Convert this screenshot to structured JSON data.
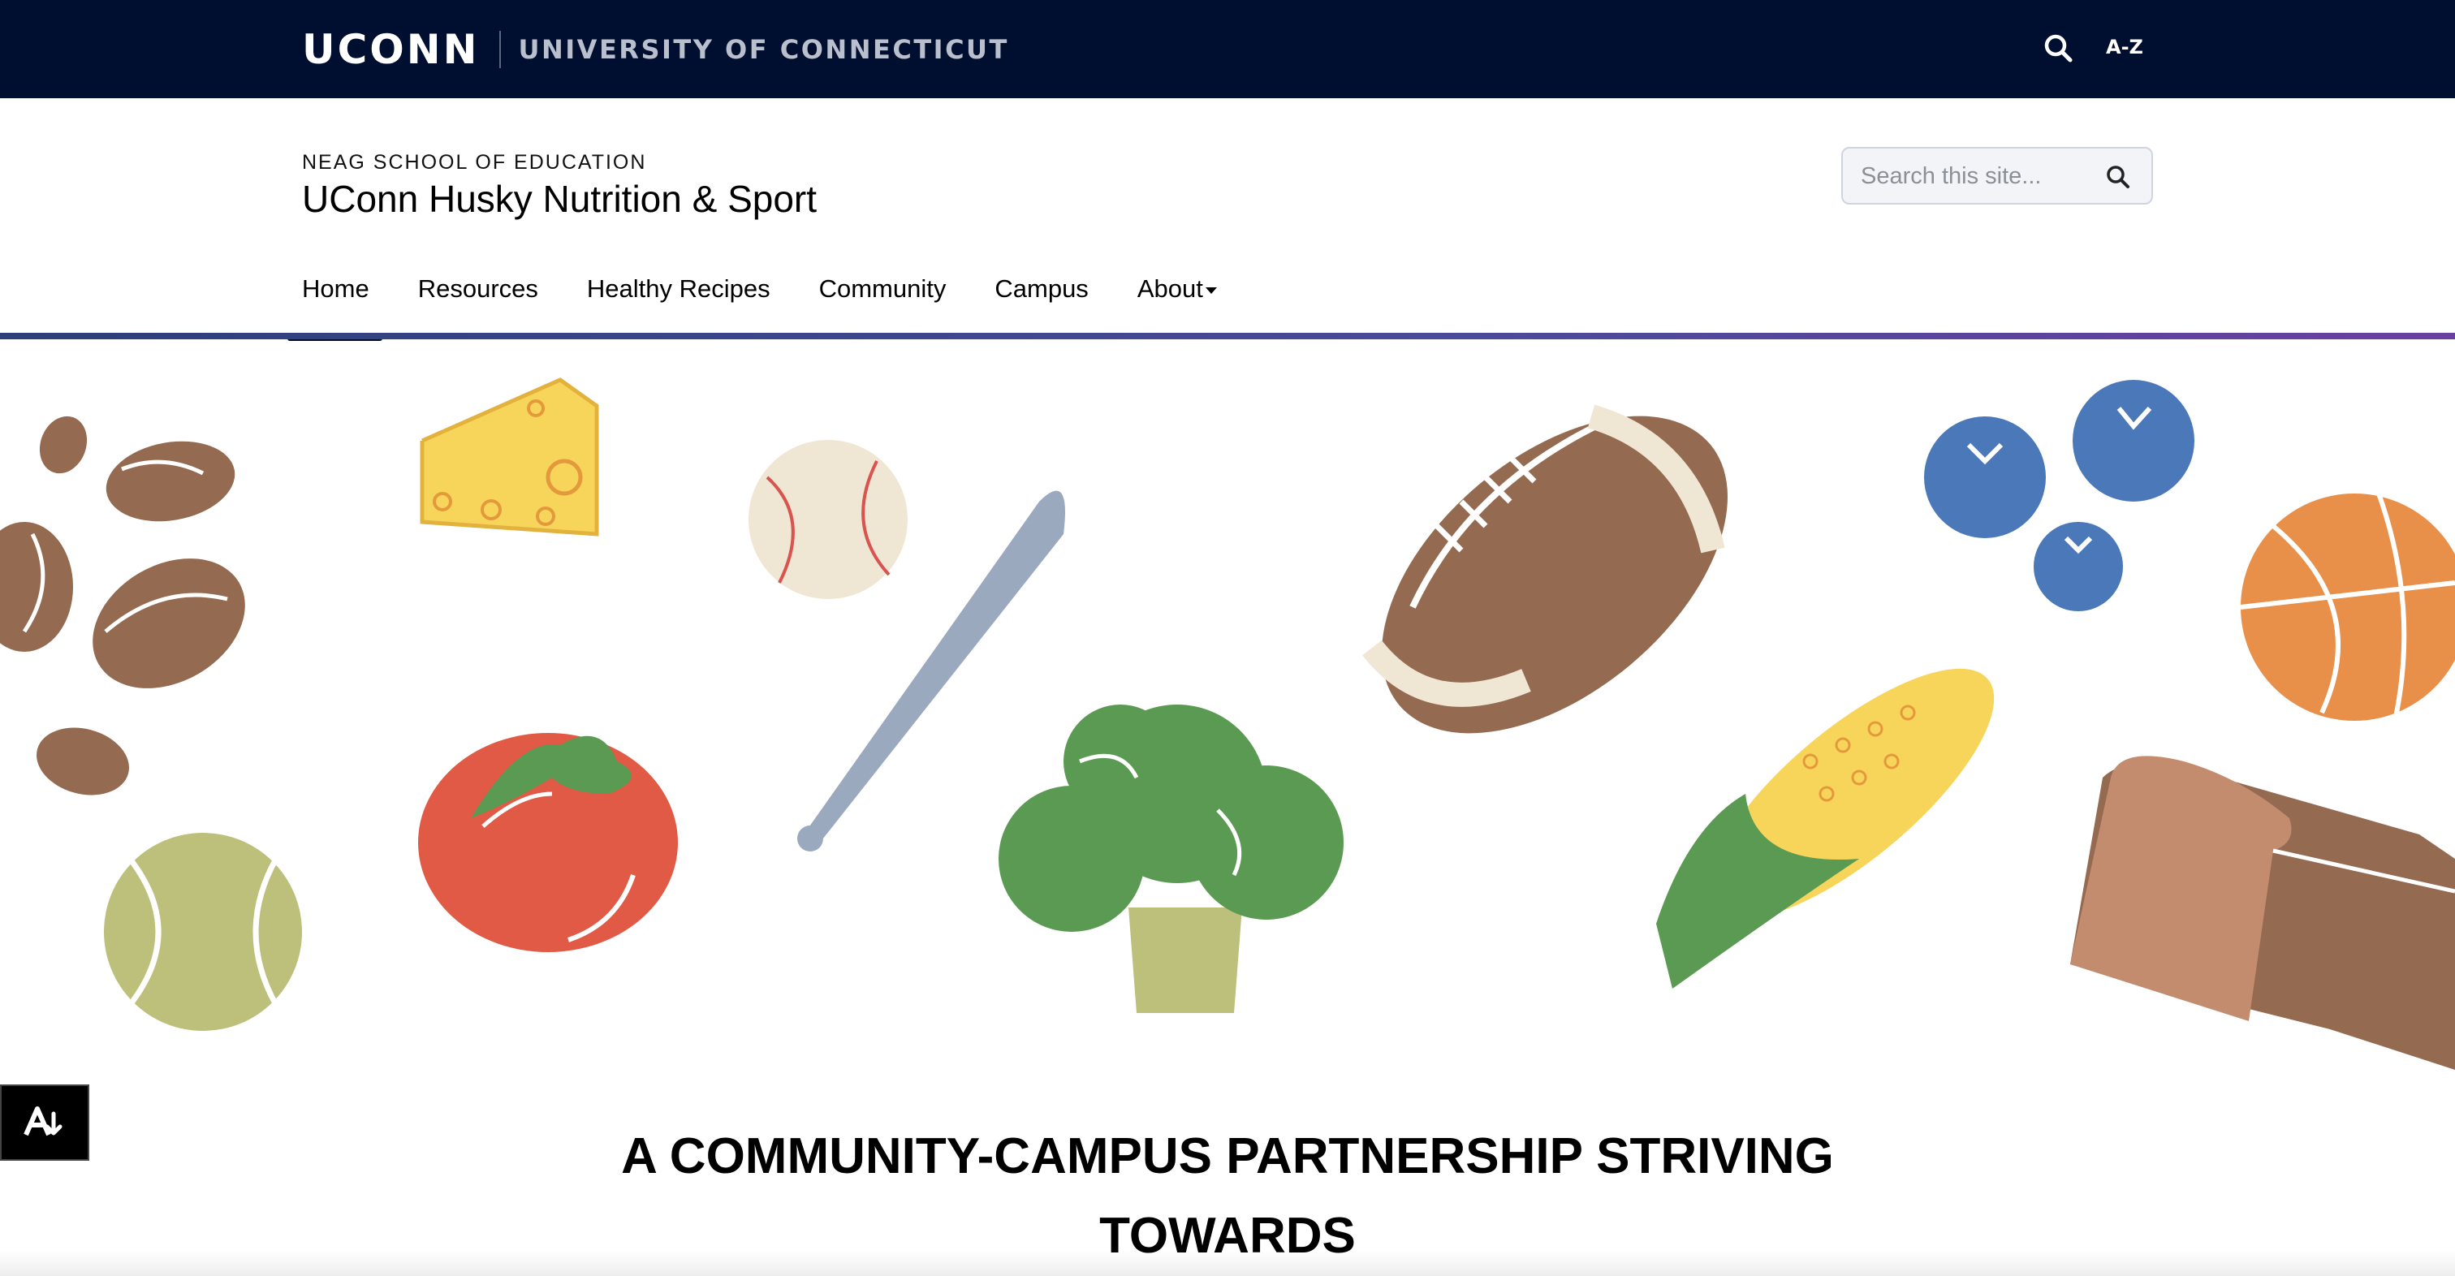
{
  "banner": {
    "wordmark": "UCONN",
    "university": "UNIVERSITY OF CONNECTICUT",
    "search_icon": "search-icon",
    "az_label": "A-Z"
  },
  "site": {
    "school": "NEAG SCHOOL OF EDUCATION",
    "title": "UConn Husky Nutrition & Sport",
    "search_placeholder": "Search this site...",
    "search_icon": "search-icon"
  },
  "nav": {
    "items": [
      {
        "label": "Home",
        "active": true
      },
      {
        "label": "Resources"
      },
      {
        "label": "Healthy Recipes"
      },
      {
        "label": "Community"
      },
      {
        "label": "Campus"
      },
      {
        "label": "About",
        "has_dropdown": true
      }
    ]
  },
  "hero": {
    "illustration_items": [
      "beans",
      "cheese",
      "baseball",
      "baseball-bat",
      "football",
      "blueberries",
      "basketball",
      "tomato",
      "broccoli",
      "corn",
      "bread",
      "tennis-ball"
    ],
    "tagline_line1": "A COMMUNITY-CAMPUS PARTNERSHIP STRIVING",
    "tagline_line2": "TOWARDS"
  },
  "accessibility": {
    "icon": "accessibility-icon"
  },
  "colors": {
    "banner": "#000e2f",
    "nav_rule_start": "#2c3f7a",
    "nav_rule_end": "#6a3fa0"
  }
}
